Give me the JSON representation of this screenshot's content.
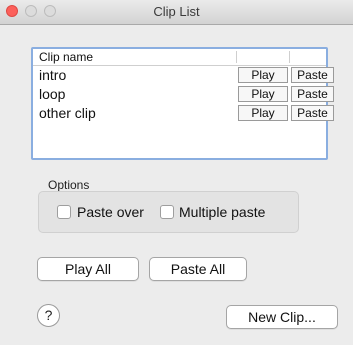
{
  "window": {
    "title": "Clip List"
  },
  "table": {
    "header": {
      "name": "Clip name"
    },
    "rows": [
      {
        "name": "intro",
        "play": "Play",
        "paste": "Paste"
      },
      {
        "name": "loop",
        "play": "Play",
        "paste": "Paste"
      },
      {
        "name": "other clip",
        "play": "Play",
        "paste": "Paste"
      }
    ]
  },
  "options": {
    "label": "Options",
    "paste_over": {
      "label": "Paste over",
      "checked": false
    },
    "multiple_paste": {
      "label": "Multiple paste",
      "checked": false
    }
  },
  "buttons": {
    "play_all": "Play All",
    "paste_all": "Paste All",
    "new_clip": "New Clip...",
    "help": "?"
  },
  "colors": {
    "close": "#fc605b",
    "focus_ring": "#8aaee0"
  }
}
